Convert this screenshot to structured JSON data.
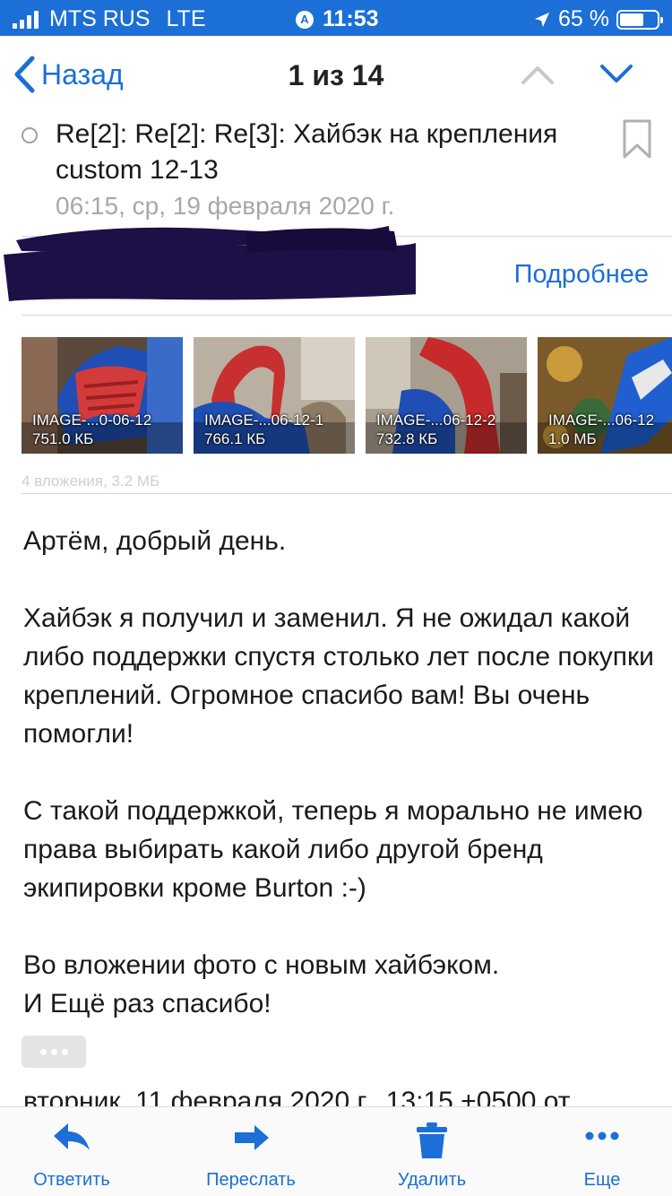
{
  "status_bar": {
    "carrier": "MTS RUS",
    "network": "LTE",
    "time": "11:53",
    "battery_percent": "65 %",
    "battery_level": 0.65,
    "signal_bars": 4
  },
  "nav": {
    "back_label": "Назад",
    "counter": "1 из 14",
    "accent_color": "#1b6fd6"
  },
  "message": {
    "subject": "Re[2]: Re[2]: Re[3]: Хайбэк на крепления custom 12-13",
    "date": "06:15, ср, 19 февраля 2020 г.",
    "details_link": "Подробнее"
  },
  "attachments": {
    "items": [
      {
        "name": "IMAGE-...0-06-12",
        "size": "751.0 КБ"
      },
      {
        "name": "IMAGE-...06-12-1",
        "size": "766.1 КБ"
      },
      {
        "name": "IMAGE-...06-12-2",
        "size": "732.8 КБ"
      },
      {
        "name": "IMAGE-...06-12",
        "size": "1.0 МБ"
      }
    ],
    "summary": "4 вложения, 3.2 МБ"
  },
  "body": {
    "greeting": "Артём, добрый день.",
    "paragraph1": "Хайбэк я получил и заменил. Я не ожидал какой либо поддержки спустя столько лет после покупки креплений. Огромное спасибо вам! Вы очень помогли!",
    "paragraph2": "С такой поддержкой, теперь я морально не имею права выбирать какой либо другой бренд экипировки кроме Burton :-)",
    "paragraph3_line1": "Во вложении фото с новым хайбэком.",
    "paragraph3_line2": "И Ещё раз спасибо!",
    "quoted_header": "вторник, 11 февраля 2020 г., 13:15 +0500 от"
  },
  "toolbar": {
    "reply": "Ответить",
    "forward": "Переслать",
    "delete": "Удалить",
    "more": "Еще"
  }
}
